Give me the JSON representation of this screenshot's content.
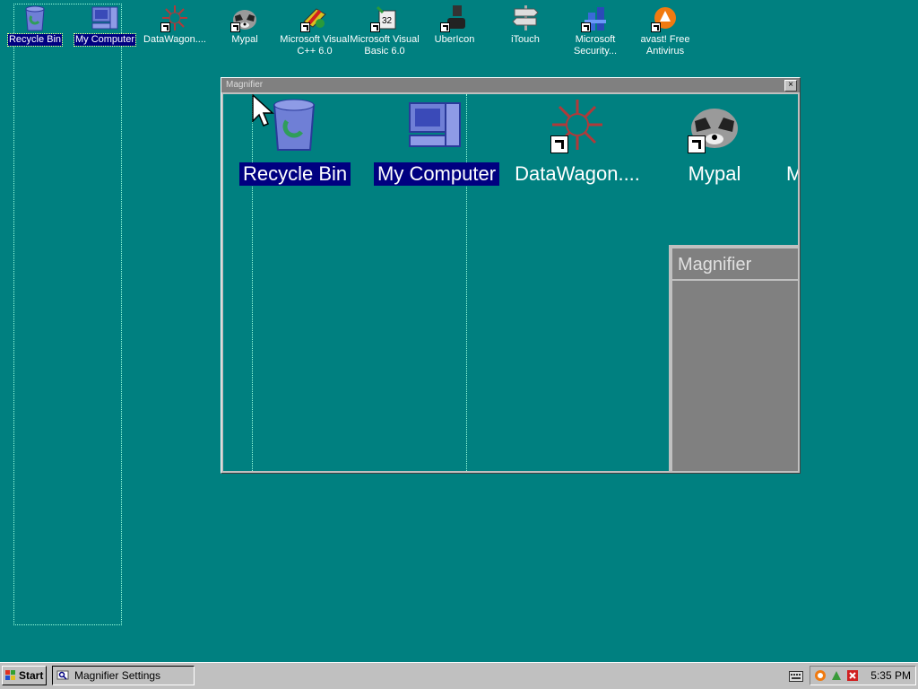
{
  "desktop": {
    "icons": [
      {
        "label": "Recycle Bin",
        "icon": "recycle-bin-icon",
        "selected": true
      },
      {
        "label": "My Computer",
        "icon": "my-computer-icon",
        "selected": true
      },
      {
        "label": "DataWagon....",
        "icon": "datawagon-icon"
      },
      {
        "label": "Mypal",
        "icon": "mypal-raccoon-icon"
      },
      {
        "label": "Microsoft Visual C++ 6.0",
        "icon": "visual-cpp-icon"
      },
      {
        "label": "Microsoft Visual Basic 6.0",
        "icon": "visual-basic-icon"
      },
      {
        "label": "UberIcon",
        "icon": "ubericon-icon"
      },
      {
        "label": "iTouch",
        "icon": "itouch-signpost-icon"
      },
      {
        "label": "Microsoft Security...",
        "icon": "microsoft-security-icon"
      },
      {
        "label": "avast! Free Antivirus",
        "icon": "avast-icon"
      }
    ]
  },
  "magnifier": {
    "title": "Magnifier",
    "close_glyph": "×",
    "zoomed_icons": [
      {
        "label": "Recycle Bin"
      },
      {
        "label": "My Computer"
      },
      {
        "label": "DataWagon...."
      },
      {
        "label": "Mypal"
      },
      {
        "label": "M"
      }
    ],
    "inner_title": "Magnifier"
  },
  "taskbar": {
    "start_label": "Start",
    "task_label": "Magnifier Settings",
    "clock": "5:35 PM"
  },
  "colors": {
    "desktop": "#008080",
    "selection": "#000080",
    "chrome": "#c0c0c0"
  }
}
